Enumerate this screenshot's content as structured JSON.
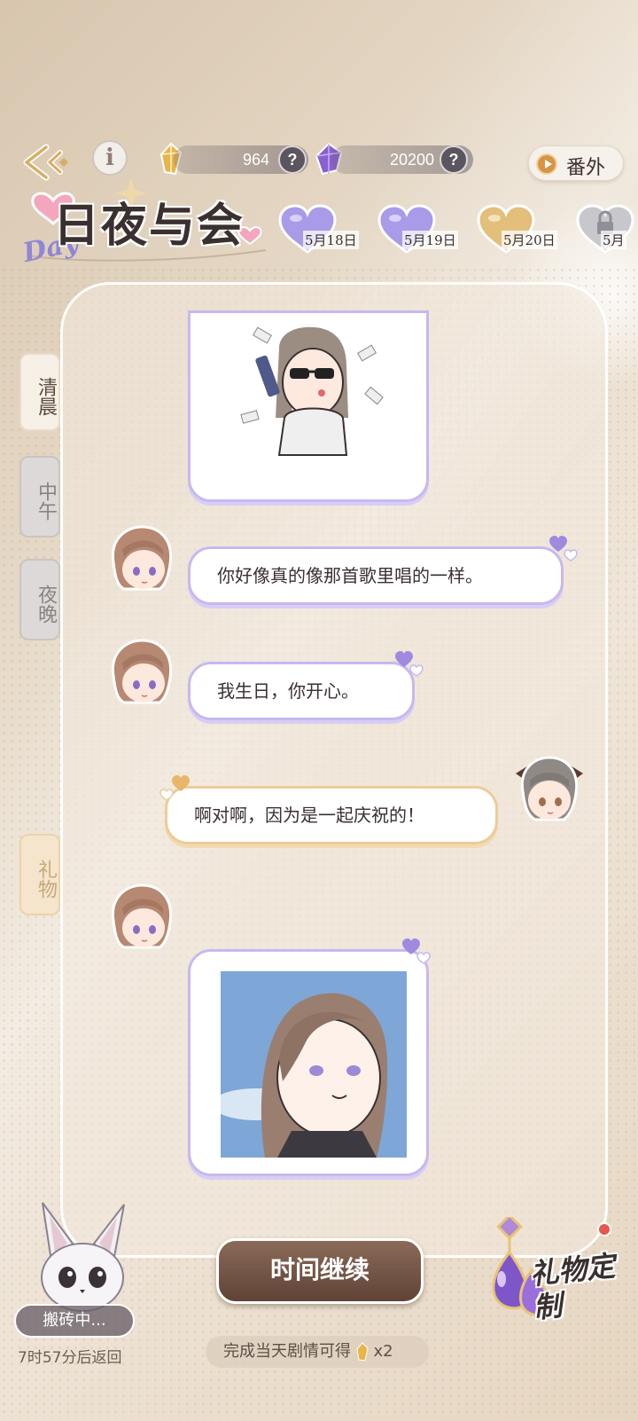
{
  "topbar": {
    "back_icon": "back-arrow-icon",
    "info_icon": "info-icon",
    "info_glyph": "i",
    "gold_amount": "964",
    "gem_amount": "20200",
    "help_glyph": "?",
    "extra_label": "番外"
  },
  "title": {
    "day_word": "Day",
    "main": "日夜与会"
  },
  "dates": [
    {
      "label": "5月18日",
      "state": "done",
      "color": "#a99be8"
    },
    {
      "label": "5月19日",
      "state": "done",
      "color": "#a99be8"
    },
    {
      "label": "5月20日",
      "state": "current",
      "color": "#e3bf7b"
    },
    {
      "label": "5月",
      "state": "locked",
      "color": "#c8c8cc"
    }
  ],
  "side_tabs": {
    "morning": "清晨",
    "noon": "中午",
    "night": "夜晚",
    "gift": "礼物"
  },
  "chat": {
    "messages": [
      {
        "side": "left",
        "text": "你好像真的像那首歌里唱的一样。"
      },
      {
        "side": "left",
        "text": "我生日，你开心。"
      },
      {
        "side": "right",
        "text": "啊对啊，因为是一起庆祝的！"
      }
    ]
  },
  "bottom": {
    "continue_label": "时间继续",
    "reward_text": "完成当天剧情可得",
    "reward_count": "x2",
    "pet_status": "搬砖中...",
    "pet_timer": "7时57分后返回",
    "gift_custom_label": "礼物定制"
  },
  "colors": {
    "accent_purple": "#c6b9ef",
    "accent_gold": "#eccc9a",
    "button_brown": "#6f5142"
  }
}
